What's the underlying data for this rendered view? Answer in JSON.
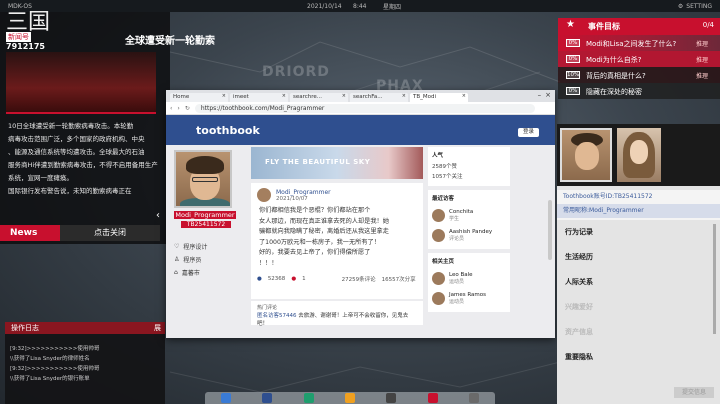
{
  "topbar": {
    "os": "MDK-OS",
    "date": "2021/10/14",
    "time": "8:44",
    "weekday": "星期四",
    "settings": "SETTING"
  },
  "map": {
    "words": [
      "DRIORD",
      "PHAX"
    ]
  },
  "news": {
    "logo_big": "三国",
    "logo_tag": "新闻号",
    "logo_num": "7912175",
    "headline": "全球遭受新一轮勤索",
    "body_lines": [
      "10日全球遭受新一轮勤索病毒攻击。本轮勤",
      "病毒攻击范围广泛，多个国家的政府机构、中央",
      "、能源及通信系统等均遭攻击。全球最大的石油",
      "服务商Hi伴遭到勤索病毒攻击，不得不启用备用生产",
      "系统，宣网一度瘫痪。",
      "国际银行发布警告说，未知的勤索病毒正在"
    ],
    "tag": "News",
    "close": "点击关闭"
  },
  "oplog": {
    "title": "操作日志",
    "expand": "展",
    "lines": [
      "[9:32]>>>>>>>>>>>使用帅哥",
      "\\\\获得了Lisa Snyder的律师姓名",
      "[9:32]>>>>>>>>>>>使用帅哥",
      "\\\\获得了Lisa Snyder的银行账单"
    ]
  },
  "browser": {
    "tabs": [
      "Home",
      "imeet",
      "searchre...",
      "searchFa...",
      "TB_Modi"
    ],
    "url": "https://toothbook.com/Modi_Pragrammer",
    "logo": "toothbook",
    "login": "登录",
    "profile": {
      "name": "Modi_Programmer",
      "id": "TB25411572",
      "links": [
        "程序设计",
        "程序员",
        "嘉蕃市"
      ]
    },
    "banner": "FLY THE BEAUTIFUL SKY",
    "post": {
      "user": "Modi_Programmer",
      "date": "2021/10/07",
      "lines": [
        "你们都相信我是个恶棍？你们都站在那个",
        "女人那边，而现在真正谁拿去死的人却是我！她",
        "骗都就向我隐瞒了秘密，离婚后还从我这里拿走",
        "了1000万欧元和一栋房子，我一无所有了！",
        "好的，我要去见上帝了，你们得偿所愿了",
        "！！！"
      ],
      "likes": "52368",
      "replies": "1",
      "views": "27259条评论",
      "shares": "16557次分享"
    },
    "comments": {
      "hot": "热门评论",
      "user": "匿名访客57446",
      "text": "去旅游、谢谢哥！上帝可不会收留你，见鬼去吧！"
    },
    "stats": {
      "title": "人气",
      "fans": "2589个赞",
      "following": "1057个关注"
    },
    "visitors": {
      "title": "最近访客",
      "items": [
        {
          "name": "Conchita",
          "sub": "学生"
        },
        {
          "name": "Aashish Pandey",
          "sub": "评论员"
        }
      ]
    },
    "related": {
      "title": "相关主页",
      "items": [
        {
          "name": "Leo Bale",
          "sub": "运动员"
        },
        {
          "name": "James Ramos",
          "sub": "运动员"
        }
      ]
    }
  },
  "events": {
    "title": "事件目标",
    "count": "0/4",
    "rows": [
      {
        "pct": "0%",
        "text": "Modi和Lisa之间发生了什么?",
        "hint": "推理"
      },
      {
        "pct": "0%",
        "text": "Modi为什么自杀?",
        "hint": "推理"
      },
      {
        "pct": "10%",
        "text": "背后的真相是什么?",
        "hint": "推理"
      },
      {
        "pct": "0%",
        "text": "隐藏在深处的秘密",
        "hint": ""
      }
    ]
  },
  "profile_panel": {
    "account": "Toothbook账号ID:TB25411572",
    "nickname": "常用昵称:Modi_Programmer",
    "sections": [
      "行为记录",
      "生活经历",
      "人际关系",
      "兴趣爱好",
      "重要隐私"
    ],
    "faded": [
      "兴趣爱好",
      "资产信息"
    ],
    "submit": "提交信息"
  },
  "colors": {
    "accent": "#c8102e",
    "toothbook": "#2f4f8f"
  }
}
